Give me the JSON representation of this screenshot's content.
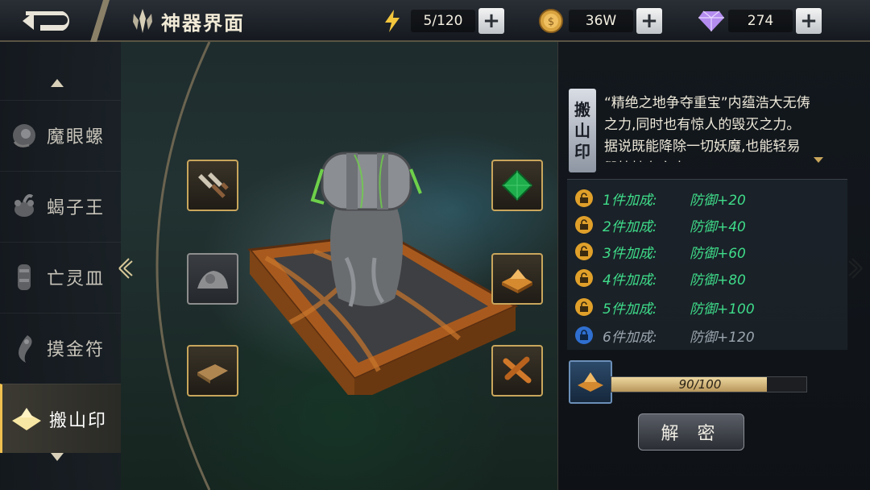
{
  "header": {
    "title": "神器界面",
    "resources": [
      {
        "name": "energy",
        "icon": "lightning-icon",
        "value": "5/120"
      },
      {
        "name": "gold",
        "icon": "gold-coin-icon",
        "value": "36W"
      },
      {
        "name": "diamond",
        "icon": "diamond-icon",
        "value": "274"
      }
    ],
    "plus_label": "+"
  },
  "menu": {
    "items": [
      {
        "label": "魔眼螺",
        "icon": "conch-icon",
        "active": false
      },
      {
        "label": "蝎子王",
        "icon": "scorpion-icon",
        "active": false
      },
      {
        "label": "亡灵皿",
        "icon": "urn-icon",
        "active": false
      },
      {
        "label": "摸金符",
        "icon": "talisman-icon",
        "active": false
      },
      {
        "label": "搬山印",
        "icon": "seal-icon",
        "active": true
      }
    ]
  },
  "artifact": {
    "name_chars": [
      "搬",
      "山",
      "印"
    ],
    "description": "“精绝之地争夺重宝”内蕴浩大无俦之力,同时也有惊人的毁灭之力。据说既能降除一切妖魔,也能轻易毁掉持有之人",
    "slots": [
      {
        "icon": "twin-blades-icon",
        "variant": "gold"
      },
      {
        "icon": "green-gem-icon",
        "variant": "gold"
      },
      {
        "icon": "stone-relic-icon",
        "variant": "grey"
      },
      {
        "icon": "bronze-seal-icon",
        "variant": "gold"
      },
      {
        "icon": "stone-tablet-icon",
        "variant": "gold"
      },
      {
        "icon": "crossed-sticks-icon",
        "variant": "gold"
      }
    ]
  },
  "bonuses": [
    {
      "label": "1件加成:",
      "value": "防御+20",
      "unlocked": true
    },
    {
      "label": "2件加成:",
      "value": "防御+40",
      "unlocked": true
    },
    {
      "label": "3件加成:",
      "value": "防御+60",
      "unlocked": true
    },
    {
      "label": "4件加成:",
      "value": "防御+80",
      "unlocked": true
    },
    {
      "label": "5件加成:",
      "value": "防御+100",
      "unlocked": true
    },
    {
      "label": "6件加成:",
      "value": "防御+120",
      "unlocked": false
    }
  ],
  "progress": {
    "text": "90/100",
    "fraction": 0.9
  },
  "decode_button": "解 密",
  "colors": {
    "accent_gold": "#c9a65c",
    "bonus_active": "#3fdc8a",
    "bonus_locked": "#9ba3ad"
  }
}
